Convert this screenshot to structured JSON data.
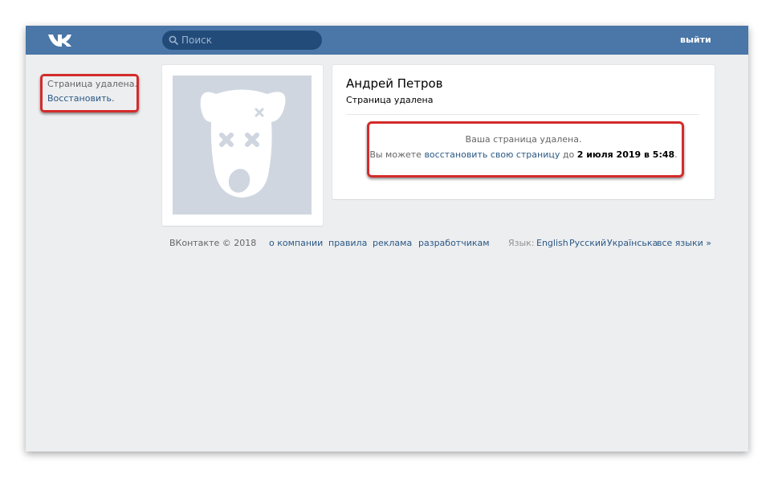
{
  "header": {
    "search_placeholder": "Поиск",
    "logout_label": "выйти"
  },
  "sidebar_notice": {
    "deleted_text": "Страница удалена.",
    "restore_link": "Восстановить."
  },
  "profile": {
    "name": "Андрей Петров",
    "status": "Страница удалена",
    "deleted_title": "Ваша страница удалена.",
    "deleted_prefix": "Вы можете ",
    "restore_link": "восстановить свою страницу",
    "deleted_middle": " до ",
    "deadline": "2 июля 2019 в 5:48",
    "deleted_suffix": "."
  },
  "footer": {
    "copyright": "ВКонтакте © 2018",
    "links": [
      "о компании",
      "правила",
      "реклама",
      "разработчикам"
    ],
    "language_label": "Язык:",
    "languages": [
      "English",
      "Русский",
      "Українська",
      "все языки »"
    ]
  },
  "colors": {
    "header": "#4a76a8",
    "link": "#2a5885",
    "highlight": "#d42b2b",
    "background": "#edeef0"
  }
}
